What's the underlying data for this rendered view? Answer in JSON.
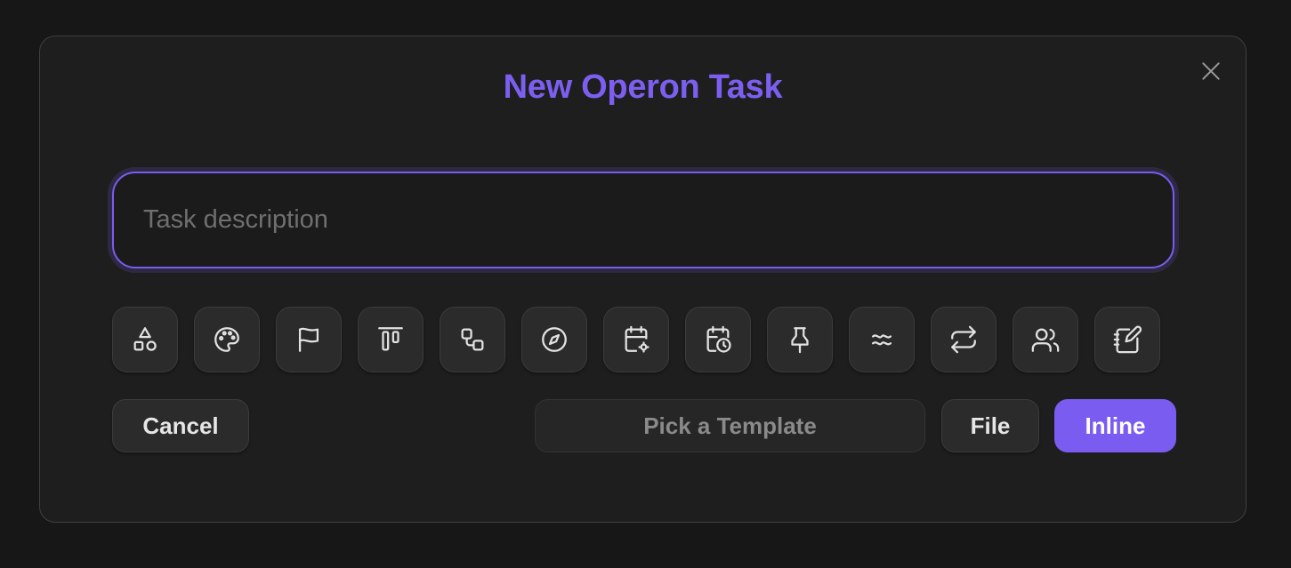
{
  "modal": {
    "title": "New Operon Task",
    "close_icon": "close-icon"
  },
  "input": {
    "placeholder": "Task description",
    "value": ""
  },
  "toolbar_icons": [
    "shapes-icon",
    "palette-icon",
    "flag-icon",
    "align-top-icon",
    "workflow-icon",
    "compass-icon",
    "calendar-cog-icon",
    "calendar-clock-icon",
    "pin-icon",
    "approx-equal-icon",
    "repeat-icon",
    "users-icon",
    "notebook-pen-icon"
  ],
  "actions": {
    "cancel_label": "Cancel",
    "template_label": "Pick a Template",
    "file_label": "File",
    "inline_label": "Inline"
  },
  "colors": {
    "accent": "#7a5cf0",
    "background": "#171717",
    "modal_bg": "#1e1e1e"
  }
}
